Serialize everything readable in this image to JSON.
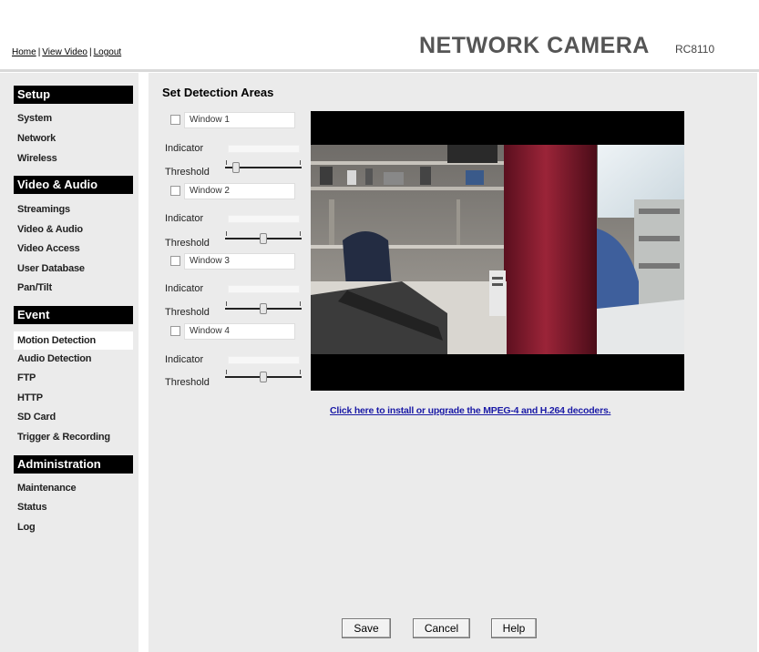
{
  "header": {
    "links": [
      {
        "label": "Home"
      },
      {
        "label": "View Video"
      },
      {
        "label": "Logout"
      }
    ],
    "separator": "|",
    "brand": "NETWORK CAMERA",
    "model": "RC8110"
  },
  "sidebar": {
    "sections": [
      {
        "title": "Setup",
        "items": [
          "System",
          "Network",
          "Wireless"
        ]
      },
      {
        "title": "Video & Audio",
        "items": [
          "Streamings",
          "Video & Audio",
          "Video Access",
          "User Database",
          "Pan/Tilt"
        ]
      },
      {
        "title": "Event",
        "items": [
          "Motion Detection",
          "Audio Detection",
          "FTP",
          "HTTP",
          "SD Card",
          "Trigger & Recording"
        ]
      },
      {
        "title": "Administration",
        "items": [
          "Maintenance",
          "Status",
          "Log"
        ]
      }
    ],
    "active_item": "Motion Detection"
  },
  "main": {
    "title": "Set Detection Areas",
    "windows": [
      {
        "name": "Window 1",
        "checked": false,
        "threshold": 0.1
      },
      {
        "name": "Window 2",
        "checked": false,
        "threshold": 0.5
      },
      {
        "name": "Window 3",
        "checked": false,
        "threshold": 0.5
      },
      {
        "name": "Window 4",
        "checked": false,
        "threshold": 0.5
      }
    ],
    "indicator_label": "Indicator",
    "threshold_label": "Threshold",
    "slider_marks": {
      "minus": "-",
      "plus": "+"
    },
    "decoder_link": "Click here to install or upgrade the MPEG-4 and H.264 decoders."
  },
  "buttons": {
    "save": "Save",
    "cancel": "Cancel",
    "help": "Help"
  },
  "colors": {
    "panel_bg": "#ebebeb",
    "section_header_bg": "#000000",
    "link_blue": "#1a1aa6"
  }
}
